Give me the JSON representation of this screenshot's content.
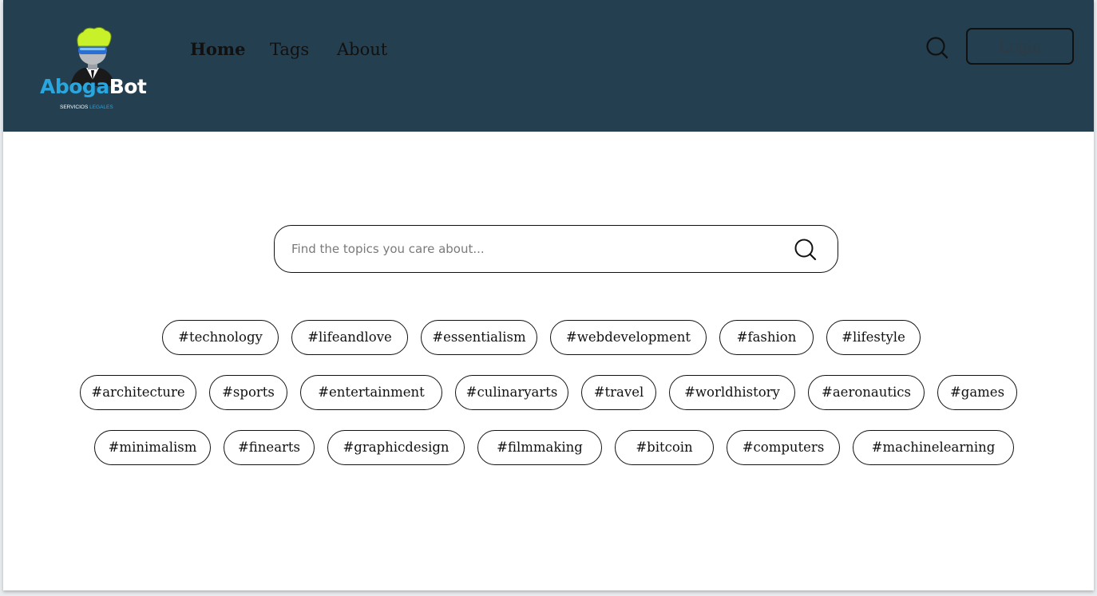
{
  "brand": {
    "name_part1": "Aboga",
    "name_part2": "Bot",
    "tagline_part1": "SERVICIOS",
    "tagline_part2": "LEGALES",
    "colors": {
      "blue": "#2aa6de",
      "lime": "#c8f12a",
      "suit": "#1a1a1a"
    }
  },
  "nav": {
    "items": [
      {
        "label": "Home",
        "active": true
      },
      {
        "label": "Tags",
        "active": false
      },
      {
        "label": "About",
        "active": false
      }
    ]
  },
  "header": {
    "search_icon": "search-icon",
    "login_label": "Login",
    "background": "#233f50"
  },
  "search": {
    "placeholder": "Find the topics you care about...",
    "value": "",
    "icon": "search-icon"
  },
  "tags": {
    "rows": [
      [
        "#technology",
        "#lifeandlove",
        "#essentialism",
        "#webdevelopment",
        "#fashion",
        "#lifestyle"
      ],
      [
        "#architecture",
        "#sports",
        "#entertainment",
        "#culinaryarts",
        "#travel",
        "#worldhistory",
        "#aeronautics",
        "#games"
      ],
      [
        "#minimalism",
        "#finearts",
        "#graphicdesign",
        "#filmmaking",
        "#bitcoin",
        "#computers",
        "#machinelearning"
      ]
    ]
  }
}
